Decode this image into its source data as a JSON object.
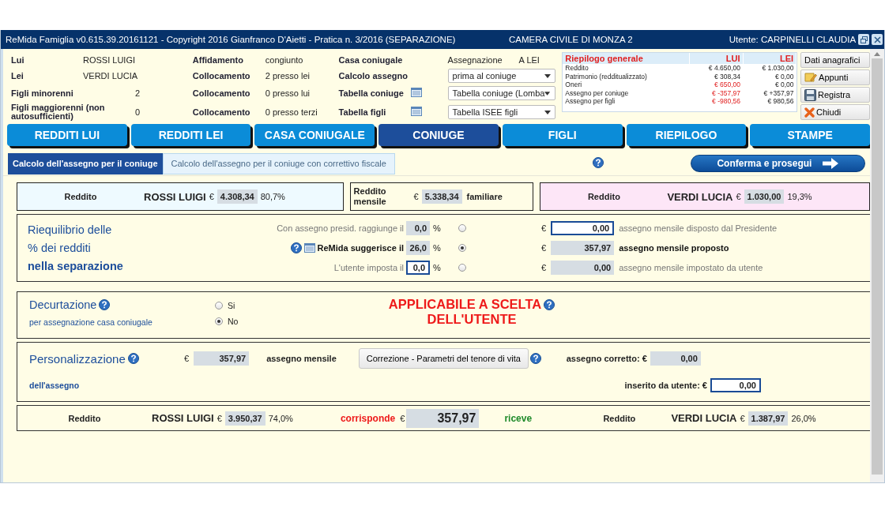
{
  "window": {
    "title": "ReMida Famiglia v0.615.39.20161121 - Copyright 2016 Gianfranco D'Aietti - Pratica n. 3/2016 (SEPARAZIONE)",
    "center": "CAMERA CIVILE DI MONZA 2",
    "user": "Utente: CARPINELLI CLAUDIA"
  },
  "header": {
    "parties": [
      {
        "label": "Lui",
        "kind": "name",
        "value": "ROSSI LUIGI"
      },
      {
        "label": "Lei",
        "kind": "name",
        "value": "VERDI LUCIA"
      },
      {
        "label": "Figli minorenni",
        "kind": "count",
        "value": "2"
      },
      {
        "label": "Figli maggiorenni (non autosufficienti)",
        "kind": "count",
        "value": "0"
      }
    ],
    "placements": [
      {
        "label": "Affidamento",
        "value": "congiunto"
      },
      {
        "label": "Collocamento",
        "value": "2 presso lei"
      },
      {
        "label": "Collocamento",
        "value": "0 presso lui"
      },
      {
        "label": "Collocamento",
        "value": "0 presso terzi"
      }
    ],
    "settings": [
      {
        "label": "Casa coniugale",
        "kind": "text",
        "key": "Assegnazione",
        "value": "A LEI"
      },
      {
        "label": "Calcolo assegno",
        "kind": "select",
        "value": "prima al coniuge"
      },
      {
        "label": "Tabella coniuge",
        "kind": "table-select",
        "value": "Tabella coniuge (Lomba"
      },
      {
        "label": "Tabella figli",
        "kind": "table-select",
        "value": "Tabella ISEE figli"
      }
    ],
    "summary": {
      "title": "Riepilogo generale",
      "columns": [
        "LUI",
        "LEI"
      ],
      "rows": [
        {
          "label": "Reddito",
          "values": [
            {
              "text": "€ 4.650,00",
              "red": false
            },
            {
              "text": "€ 1.030,00",
              "red": false
            }
          ]
        },
        {
          "label": "Patrimonio (redditualizzato)",
          "values": [
            {
              "text": "€ 308,34",
              "red": false
            },
            {
              "text": "€ 0,00",
              "red": false
            }
          ]
        },
        {
          "label": "Oneri",
          "values": [
            {
              "text": "€ 650,00",
              "red": true
            },
            {
              "text": "€ 0,00",
              "red": false
            }
          ]
        },
        {
          "label": "Assegno per coniuge",
          "values": [
            {
              "text": "€ -357,97",
              "red": true
            },
            {
              "text": "€ +357,97",
              "red": false
            }
          ]
        },
        {
          "label": "Assegno per figli",
          "values": [
            {
              "text": "€ -980,56",
              "red": true
            },
            {
              "text": "€ 980,56",
              "red": false
            }
          ]
        }
      ]
    },
    "side_buttons": [
      {
        "label": "Dati anagrafici",
        "kind": "plain"
      },
      {
        "label": "Appunti",
        "kind": "note"
      },
      {
        "label": "Registra",
        "kind": "save"
      },
      {
        "label": "Chiudi",
        "kind": "close"
      }
    ]
  },
  "nav_tabs": [
    {
      "label": "REDDITI LUI",
      "selected": false
    },
    {
      "label": "REDDITI LEI",
      "selected": false
    },
    {
      "label": "CASA CONIUGALE",
      "selected": false
    },
    {
      "label": "CONIUGE",
      "selected": true
    },
    {
      "label": "FIGLI",
      "selected": false
    },
    {
      "label": "RIEPILOGO",
      "selected": false
    },
    {
      "label": "STAMPE",
      "selected": false
    }
  ],
  "sub_tabs": [
    {
      "label": "Calcolo dell'assegno per il coniuge",
      "selected": true
    },
    {
      "label": "Calcolo dell'assegno per il coniuge con correttivo fiscale",
      "selected": false
    }
  ],
  "confirm_button": "Conferma e prosegui",
  "income": {
    "lui": {
      "label": "Reddito",
      "name": "ROSSI LUIGI",
      "currency": "€",
      "amount": "4.308,34",
      "percent": "80,7%"
    },
    "family": {
      "label": "Reddito mensile",
      "currency": "€",
      "amount": "5.338,34",
      "suffix": "familiare"
    },
    "lei": {
      "label": "Reddito",
      "name": "VERDI LUCIA",
      "currency": "€",
      "amount": "1.030,00",
      "percent": "19,3%"
    }
  },
  "rebalance": {
    "title_lines": [
      "Riequilibrio delle",
      "% dei redditi",
      "nella separazione"
    ],
    "options": [
      {
        "kind": "plain",
        "label": "Con assegno presid. raggiunge il",
        "percent": {
          "value": "0,0",
          "editable": false
        },
        "unit": "%",
        "selected": false,
        "currency": "€",
        "amount": {
          "value": "0,00",
          "editable": true
        },
        "description": "assegno mensile disposto dal Presidente"
      },
      {
        "kind": "suggested",
        "label": "ReMida suggerisce il",
        "percent": {
          "value": "26,0",
          "editable": false
        },
        "unit": "%",
        "selected": true,
        "currency": "€",
        "amount": {
          "value": "357,97",
          "editable": false
        },
        "description": "assegno mensile proposto"
      },
      {
        "kind": "plain",
        "label": "L'utente imposta il",
        "percent": {
          "value": "0,0",
          "editable": true
        },
        "unit": "%",
        "selected": false,
        "currency": "€",
        "amount": {
          "value": "0,00",
          "editable": false
        },
        "description": "assegno mensile impostato da utente"
      }
    ]
  },
  "decurtazione": {
    "title": "Decurtazione",
    "subtitle": "per assegnazione casa coniugale",
    "options": [
      {
        "label": "Si",
        "selected": false
      },
      {
        "label": "No",
        "selected": true
      }
    ],
    "notice_lines": [
      "APPLICABILE A SCELTA",
      "DELL'UTENTE"
    ]
  },
  "personalization": {
    "title": "Personalizzazione",
    "subtitle": "dell'assegno",
    "currency": "€",
    "amount": "357,97",
    "amount_label": "assegno mensile",
    "button": "Correzione - Parametri del tenore di vita",
    "corrected_label": "assegno corretto: €",
    "corrected": {
      "value": "0,00",
      "editable": false
    },
    "user_label": "inserito da utente: €",
    "user_value": {
      "value": "0,00",
      "editable": true
    }
  },
  "result": {
    "lui": {
      "label": "Reddito",
      "name": "ROSSI LUIGI",
      "currency": "€",
      "amount": "3.950,37",
      "percent": "74,0%"
    },
    "pays": "corrisponde",
    "currency": "€",
    "amount": "357,97",
    "receives": "riceve",
    "lei": {
      "label": "Reddito",
      "name": "VERDI LUCIA",
      "currency": "€",
      "amount": "1.387,97",
      "percent": "26,0%"
    }
  }
}
